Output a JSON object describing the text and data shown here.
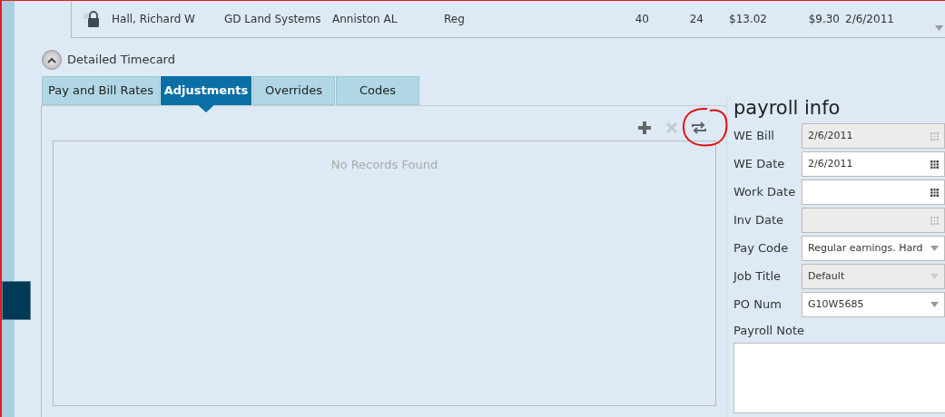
{
  "grid_row": {
    "cells": [
      "Hall, Richard W",
      "GD Land Systems",
      "Anniston AL",
      "Reg",
      "40",
      "24",
      "$13.02",
      "$9.30",
      "2/6/2011"
    ]
  },
  "section": {
    "title": "Detailed Timecard",
    "expanded": true
  },
  "tabs": [
    {
      "label": "Pay and Bill Rates",
      "selected": false
    },
    {
      "label": "Adjustments",
      "selected": true
    },
    {
      "label": "Overrides",
      "selected": false
    },
    {
      "label": "Codes",
      "selected": false
    }
  ],
  "toolbar": [
    {
      "kind": "add",
      "disabled": false
    },
    {
      "kind": "delete",
      "disabled": true
    },
    {
      "kind": "refresh",
      "disabled": false,
      "circled": true
    }
  ],
  "records": {
    "empty_message": "No Records Found"
  },
  "payroll_info": {
    "title": "payroll info",
    "fields": [
      {
        "label": "WE Bill",
        "kind": "date",
        "value": "2/6/2011",
        "disabled": true
      },
      {
        "label": "WE Date",
        "kind": "date",
        "value": "2/6/2011",
        "disabled": false
      },
      {
        "label": "Work Date",
        "kind": "date",
        "disabled": false
      },
      {
        "label": "Inv Date",
        "kind": "date",
        "disabled": true
      },
      {
        "label": "Pay Code",
        "kind": "select",
        "value": "Regular earnings.  Hard",
        "disabled": false
      },
      {
        "label": "Job Title",
        "kind": "select",
        "value": "Default",
        "disabled": true
      },
      {
        "label": "PO Num",
        "kind": "select",
        "value": "G10W5685",
        "disabled": false
      }
    ],
    "note_label": "Payroll Note"
  }
}
